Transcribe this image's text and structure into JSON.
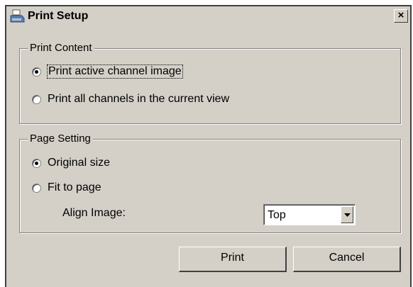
{
  "window": {
    "title": "Print Setup",
    "icon": "printer-icon",
    "close_label": "×"
  },
  "print_content": {
    "legend": "Print Content",
    "options": [
      {
        "label": "Print active channel image",
        "checked": true
      },
      {
        "label": "Print all channels in the current view",
        "checked": false
      }
    ]
  },
  "page_setting": {
    "legend": "Page Setting",
    "options": [
      {
        "label": "Original size",
        "checked": true
      },
      {
        "label": "Fit to page",
        "checked": false
      }
    ],
    "align_label": "Align Image:",
    "align_value": "Top"
  },
  "buttons": {
    "print": "Print",
    "cancel": "Cancel"
  },
  "colors": {
    "dialog_bg": "#d4d0c8",
    "border_dark": "#404040",
    "border_light": "#ffffff"
  }
}
